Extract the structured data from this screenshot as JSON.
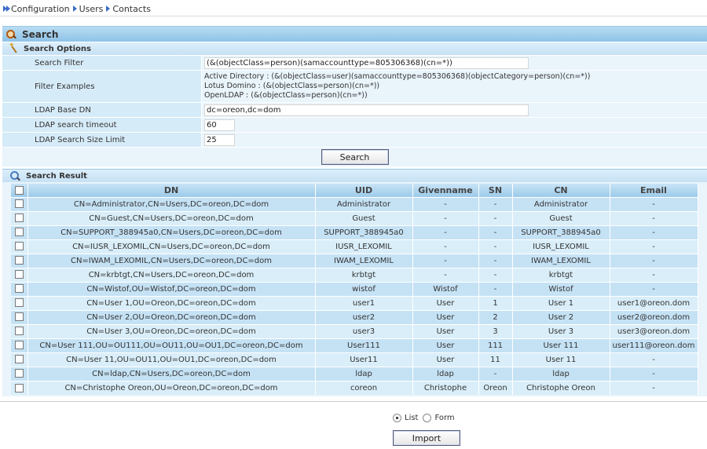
{
  "breadcrumb": [
    "Configuration",
    "Users",
    "Contacts"
  ],
  "panel_title": "Search",
  "options_title": "Search Options",
  "options": {
    "filter_label": "Search Filter",
    "filter_value": "(&(objectClass=person)(samaccounttype=805306368)(cn=*))",
    "examples_label": "Filter Examples",
    "examples": [
      "Active Directory : (&(objectClass=user)(samaccounttype=805306368)(objectCategory=person)(cn=*))",
      "Lotus Domino : (&(objectClass=person)(cn=*))",
      "OpenLDAP : (&(objectClass=person)(cn=*))"
    ],
    "base_dn_label": "LDAP Base DN",
    "base_dn_value": "dc=oreon,dc=dom",
    "timeout_label": "LDAP search timeout",
    "timeout_value": "60",
    "size_limit_label": "LDAP Search Size Limit",
    "size_limit_value": "25"
  },
  "search_button": "Search",
  "result_title": "Search Result",
  "columns": [
    "DN",
    "UID",
    "Givenname",
    "SN",
    "CN",
    "Email"
  ],
  "rows": [
    [
      "CN=Administrator,CN=Users,DC=oreon,DC=dom",
      "Administrator",
      "-",
      "-",
      "Administrator",
      "-"
    ],
    [
      "CN=Guest,CN=Users,DC=oreon,DC=dom",
      "Guest",
      "-",
      "-",
      "Guest",
      "-"
    ],
    [
      "CN=SUPPORT_388945a0,CN=Users,DC=oreon,DC=dom",
      "SUPPORT_388945a0",
      "-",
      "-",
      "SUPPORT_388945a0",
      "-"
    ],
    [
      "CN=IUSR_LEXOMIL,CN=Users,DC=oreon,DC=dom",
      "IUSR_LEXOMIL",
      "-",
      "-",
      "IUSR_LEXOMIL",
      "-"
    ],
    [
      "CN=IWAM_LEXOMIL,CN=Users,DC=oreon,DC=dom",
      "IWAM_LEXOMIL",
      "-",
      "-",
      "IWAM_LEXOMIL",
      "-"
    ],
    [
      "CN=krbtgt,CN=Users,DC=oreon,DC=dom",
      "krbtgt",
      "-",
      "-",
      "krbtgt",
      "-"
    ],
    [
      "CN=Wistof,OU=Wistof,DC=oreon,DC=dom",
      "wistof",
      "Wistof",
      "-",
      "Wistof",
      "-"
    ],
    [
      "CN=User 1,OU=Oreon,DC=oreon,DC=dom",
      "user1",
      "User",
      "1",
      "User 1",
      "user1@oreon.dom"
    ],
    [
      "CN=User 2,OU=Oreon,DC=oreon,DC=dom",
      "user2",
      "User",
      "2",
      "User 2",
      "user2@oreon.dom"
    ],
    [
      "CN=User 3,OU=Oreon,DC=oreon,DC=dom",
      "user3",
      "User",
      "3",
      "User 3",
      "user3@oreon.dom"
    ],
    [
      "CN=User 111,OU=OU111,OU=OU11,OU=OU1,DC=oreon,DC=dom",
      "User111",
      "User",
      "111",
      "User 111",
      "user111@oreon.dom"
    ],
    [
      "CN=User 11,OU=OU11,OU=OU1,DC=oreon,DC=dom",
      "User11",
      "User",
      "11",
      "User 11",
      "-"
    ],
    [
      "CN=ldap,CN=Users,DC=oreon,DC=dom",
      "ldap",
      "ldap",
      "-",
      "ldap",
      "-"
    ],
    [
      "CN=Christophe Oreon,OU=Oreon,DC=oreon,DC=dom",
      "coreon",
      "Christophe",
      "Oreon",
      "Christophe Oreon",
      "-"
    ]
  ],
  "view_options": [
    "List",
    "Form"
  ],
  "selected_view": "List",
  "import_button": "Import"
}
